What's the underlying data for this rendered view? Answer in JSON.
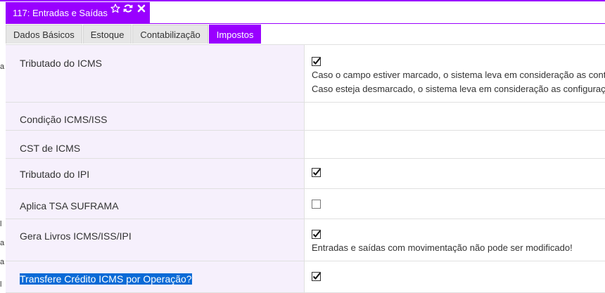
{
  "window": {
    "title": "117: Entradas e Saídas"
  },
  "tabs": [
    {
      "label": "Dados Básicos"
    },
    {
      "label": "Estoque"
    },
    {
      "label": "Contabilização"
    },
    {
      "label": "Impostos"
    }
  ],
  "active_tab": "Impostos",
  "left_edge_chars": [
    "a",
    "l",
    "a",
    "a",
    "l"
  ],
  "fields": [
    {
      "label": "Tributado do ICMS",
      "checked": true,
      "description": [
        "Caso o campo estiver marcado, o sistema leva em consideração as cont",
        "Caso esteja desmarcado, o sistema leva em consideração as configuraç"
      ]
    },
    {
      "label": "Condição ICMS/ISS"
    },
    {
      "label": "CST de ICMS"
    },
    {
      "label": "Tributado do IPI",
      "checked": true
    },
    {
      "label": "Aplica TSA SUFRAMA",
      "checked": false
    },
    {
      "label": "Gera Livros ICMS/ISS/IPI",
      "checked": true,
      "description": [
        "Entradas e saídas com movimentação não pode ser modificado!"
      ]
    },
    {
      "label": "Transfere Crédito ICMS por Operação?",
      "checked": true,
      "label_selected": true
    }
  ],
  "colors": {
    "accent": "#9900ff",
    "label_bg": "#f6f0fc",
    "selection": "#0a6ad6"
  },
  "icons": {
    "favorite": "star-icon",
    "refresh": "refresh-icon",
    "close": "close-icon"
  }
}
